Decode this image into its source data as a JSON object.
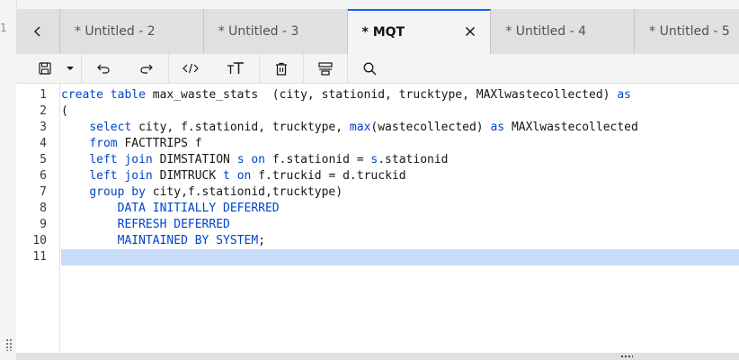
{
  "left_rail": {
    "fragment": "1"
  },
  "tabs": [
    {
      "label": "* Untitled - 2",
      "active": false
    },
    {
      "label": "* Untitled - 3",
      "active": false
    },
    {
      "label": "* MQT",
      "active": true
    },
    {
      "label": "* Untitled - 4",
      "active": false
    },
    {
      "label": "* Untitled - 5",
      "active": false
    }
  ],
  "toolbar": {
    "icons": [
      "save-icon",
      "chevron-down-icon",
      "undo-icon",
      "redo-icon",
      "code-format-icon",
      "text-size-icon",
      "trash-icon",
      "layout-icon",
      "search-icon"
    ]
  },
  "editor": {
    "current_line": 11,
    "line_numbers": [
      "1",
      "2",
      "3",
      "4",
      "5",
      "6",
      "7",
      "8",
      "9",
      "10",
      "11"
    ],
    "lines": [
      [
        [
          "kw",
          "create table"
        ],
        [
          "",
          "max_waste_stats  (city, stationid, trucktype, MAXlwastecollected) "
        ],
        [
          "kw",
          "as"
        ]
      ],
      [
        [
          "",
          "("
        ]
      ],
      [
        [
          "",
          "    "
        ],
        [
          "kw",
          "select"
        ],
        [
          "",
          "city, f.stationid, trucktype, "
        ],
        [
          "kw",
          "max"
        ],
        [
          "",
          "(wastecollected) "
        ],
        [
          "kw",
          "as"
        ],
        [
          "",
          "MAXlwastecollected"
        ]
      ],
      [
        [
          "",
          "    "
        ],
        [
          "kw",
          "from"
        ],
        [
          "",
          "FACTTRIPS f"
        ]
      ],
      [
        [
          "",
          "    "
        ],
        [
          "kw",
          "left join"
        ],
        [
          "",
          "DIMSTATION "
        ],
        [
          "kw",
          "s on"
        ],
        [
          "",
          "f.stationid = "
        ],
        [
          "kw",
          "s"
        ],
        [
          "",
          ".stationid"
        ]
      ],
      [
        [
          "",
          "    "
        ],
        [
          "kw",
          "left join"
        ],
        [
          "",
          "DIMTRUCK "
        ],
        [
          "kw",
          "t on"
        ],
        [
          "",
          "f.truckid = d.truckid"
        ]
      ],
      [
        [
          "",
          "    "
        ],
        [
          "kw",
          "group by"
        ],
        [
          "",
          "city,f.stationid,trucktype)"
        ]
      ],
      [
        [
          "",
          "        "
        ],
        [
          "kw",
          "DATA INITIALLY DEFERRED"
        ]
      ],
      [
        [
          "",
          "        "
        ],
        [
          "kw",
          "REFRESH DEFERRED"
        ]
      ],
      [
        [
          "",
          "        "
        ],
        [
          "kw",
          "MAINTAINED BY SYSTEM"
        ],
        [
          "",
          ";"
        ]
      ],
      [
        [
          "",
          ""
        ]
      ]
    ]
  }
}
